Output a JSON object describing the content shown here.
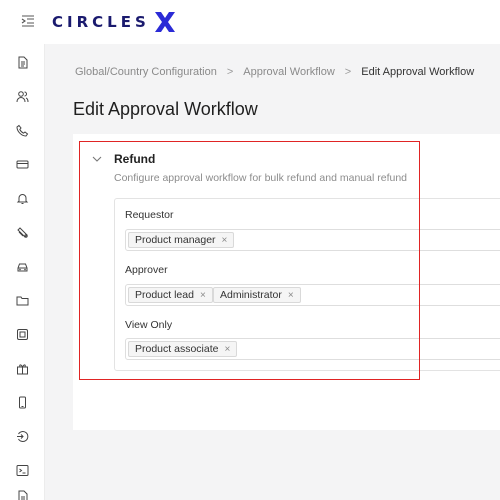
{
  "app": {
    "logo_text": "CIRCLES",
    "logo_mark": "X"
  },
  "sidebar": {
    "icons": [
      "document-icon",
      "users-icon",
      "phone-icon",
      "card-icon",
      "bell-icon",
      "ticket-icon",
      "car-icon",
      "folder-icon",
      "sim-icon",
      "gift-icon",
      "mobile-icon",
      "login-icon",
      "terminal-icon",
      "file-icon"
    ]
  },
  "breadcrumb": {
    "items": [
      "Global/Country Configuration",
      "Approval Workflow",
      "Edit Approval Workflow"
    ],
    "separator": ">"
  },
  "page": {
    "title": "Edit Approval Workflow"
  },
  "section": {
    "title": "Refund",
    "description": "Configure approval workflow for bulk refund and manual refund",
    "fields": [
      {
        "label": "Requestor",
        "tags": [
          "Product manager"
        ]
      },
      {
        "label": "Approver",
        "tags": [
          "Product lead",
          "Administrator"
        ]
      },
      {
        "label": "View Only",
        "tags": [
          "Product associate"
        ]
      }
    ],
    "tag_remove_glyph": "×"
  },
  "colors": {
    "brand": "#1a1a6e",
    "brand_accent": "#2b2bd6",
    "highlight": "#e02424"
  }
}
